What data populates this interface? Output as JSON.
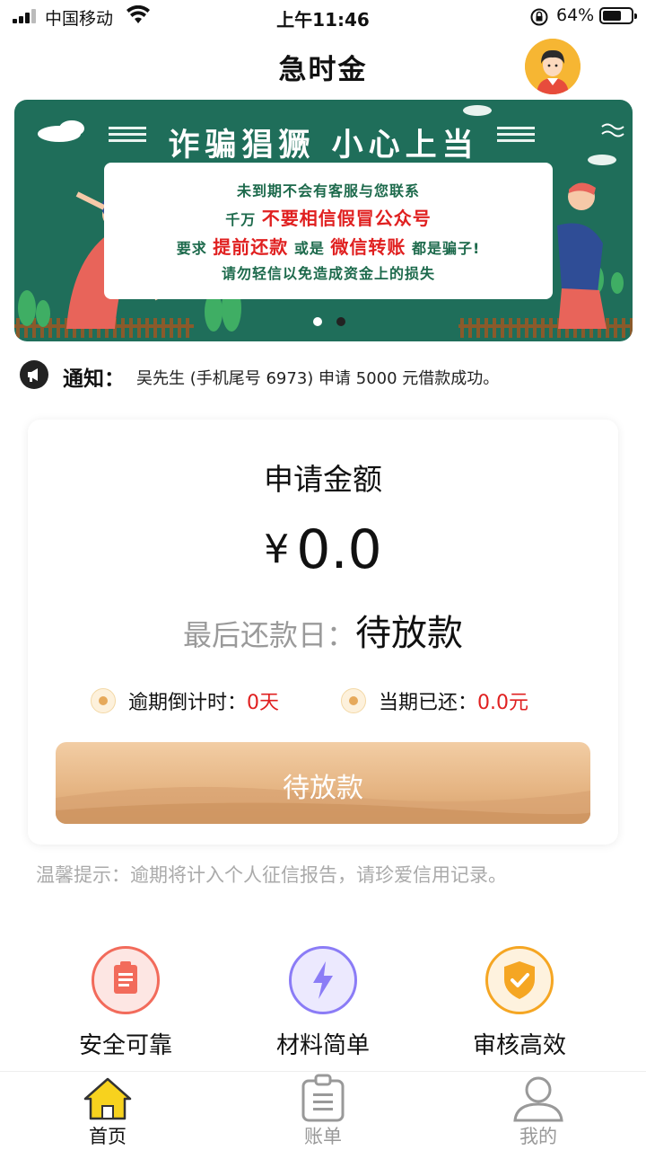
{
  "status_bar": {
    "carrier": "中国移动",
    "time": "上午11:46",
    "battery": "64%",
    "battery_level": 0.64
  },
  "header": {
    "title": "急时金"
  },
  "banner": {
    "title": "诈骗猖獗 小心上当",
    "lines": [
      {
        "a": "未到期不会有客服与您联系",
        "red": "",
        "b": ""
      },
      {
        "a": "千万 ",
        "red": "不要相信假冒公众号",
        "b": ""
      },
      {
        "a": "要求 ",
        "red": "提前还款",
        "b": " 或是 "
      },
      {
        "a": "请勿轻信以免造成资金上的损失",
        "red": "",
        "b": ""
      }
    ],
    "line3_red2": "微信转账",
    "line3_tail": " 都是骗子!",
    "active_slide": 2,
    "slide_count": 2
  },
  "notification": {
    "label": "通知：",
    "text": "吴先生 (手机尾号 6973) 申请 5000 元借款成功。"
  },
  "loan_card": {
    "title": "申请金额",
    "currency": "¥",
    "amount": "0.0",
    "due_label": "最后还款日：",
    "due_value": "待放款",
    "countdown_label": "逾期倒计时：",
    "countdown_value": "0天",
    "repaid_label": "当期已还：",
    "repaid_value": "0.0元",
    "button_label": "待放款"
  },
  "tip": "温馨提示：逾期将计入个人征信报告，请珍爱信用记录。",
  "features": [
    {
      "label": "安全可靠",
      "icon": "clipboard-icon",
      "color": "#f26b5b"
    },
    {
      "label": "材料简单",
      "icon": "lightning-icon",
      "color": "#8b7cf6"
    },
    {
      "label": "审核高效",
      "icon": "shield-check-icon",
      "color": "#f5a623"
    }
  ],
  "tabbar": {
    "items": [
      {
        "label": "首页",
        "icon": "home-icon",
        "active": true
      },
      {
        "label": "账单",
        "icon": "bill-icon",
        "active": false
      },
      {
        "label": "我的",
        "icon": "profile-icon",
        "active": false
      }
    ]
  },
  "colors": {
    "accent_red": "#e02020",
    "button_gold": "#e5b482",
    "banner_green": "#1f6e5a",
    "banner_orange": "#f7b21e",
    "home_yellow": "#f7d21e"
  }
}
